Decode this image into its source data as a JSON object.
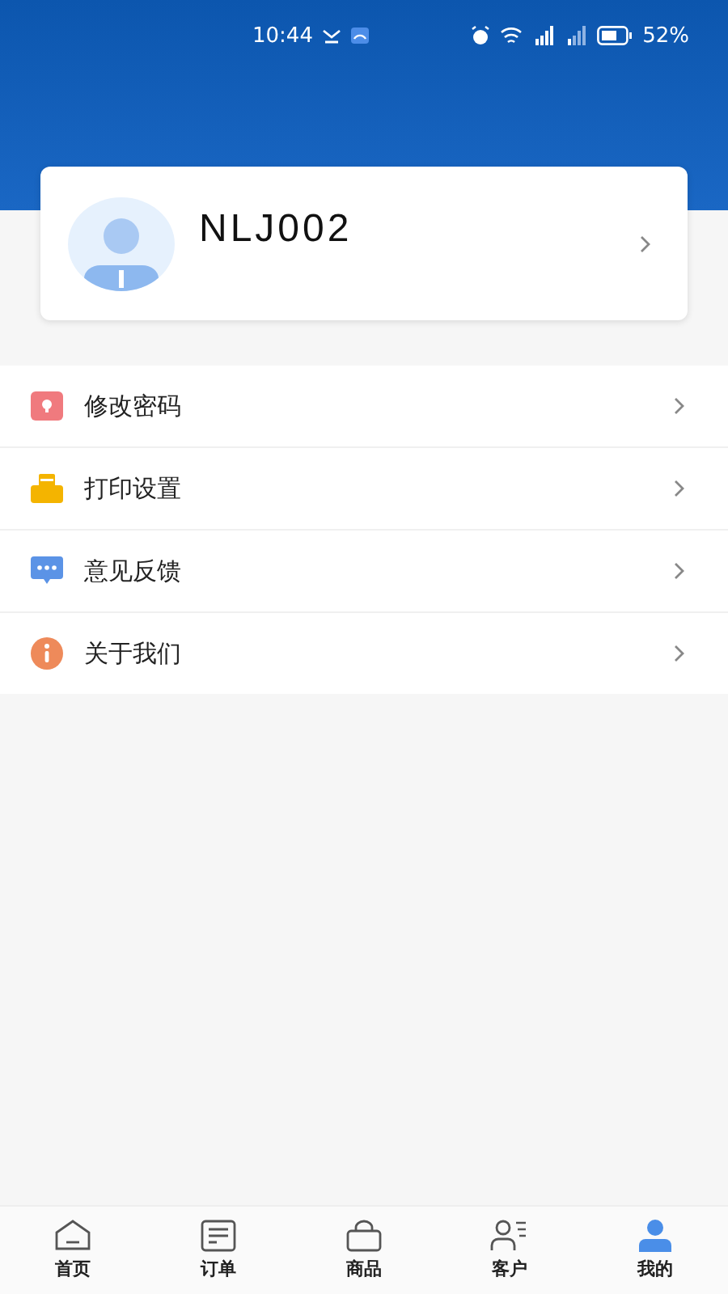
{
  "status_bar": {
    "time": "10:44",
    "battery": "52%"
  },
  "profile": {
    "name": "NLJ002"
  },
  "menu": [
    {
      "kind": "lock",
      "label": "修改密码"
    },
    {
      "kind": "printer",
      "label": "打印设置"
    },
    {
      "kind": "feedback",
      "label": "意见反馈"
    },
    {
      "kind": "info",
      "label": "关于我们"
    }
  ],
  "tab_bar": [
    {
      "kind": "home",
      "label": "首页",
      "selected": false
    },
    {
      "kind": "orders",
      "label": "订单",
      "selected": false
    },
    {
      "kind": "goods",
      "label": "商品",
      "selected": false
    },
    {
      "kind": "customers",
      "label": "客户",
      "selected": false
    },
    {
      "kind": "me",
      "label": "我的",
      "selected": true
    }
  ]
}
